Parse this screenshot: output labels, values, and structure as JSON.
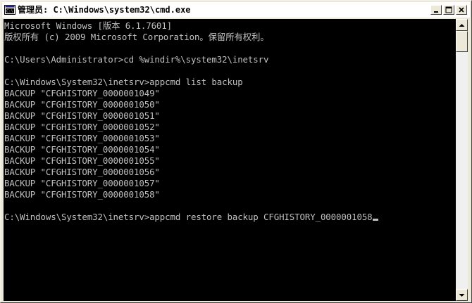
{
  "window": {
    "title": "管理员: C:\\Windows\\system32\\cmd.exe",
    "app_icon": "command-prompt-icon",
    "caption_buttons": [
      "minimize-icon",
      "maximize-icon",
      "close-icon"
    ]
  },
  "console": {
    "text_color": "#c0c0c0",
    "background": "#000000",
    "lines": [
      "Microsoft Windows [版本 6.1.7601]",
      "版权所有 (c) 2009 Microsoft Corporation。保留所有权利。",
      "",
      "C:\\Users\\Administrator>cd %windir%\\system32\\inetsrv",
      "",
      "C:\\Windows\\System32\\inetsrv>appcmd list backup",
      "BACKUP \"CFGHISTORY_0000001049\"",
      "BACKUP \"CFGHISTORY_0000001050\"",
      "BACKUP \"CFGHISTORY_0000001051\"",
      "BACKUP \"CFGHISTORY_0000001052\"",
      "BACKUP \"CFGHISTORY_0000001053\"",
      "BACKUP \"CFGHISTORY_0000001054\"",
      "BACKUP \"CFGHISTORY_0000001055\"",
      "BACKUP \"CFGHISTORY_0000001056\"",
      "BACKUP \"CFGHISTORY_0000001057\"",
      "BACKUP \"CFGHISTORY_0000001058\"",
      "",
      "C:\\Windows\\System32\\inetsrv>appcmd restore backup CFGHISTORY_0000001058"
    ]
  }
}
